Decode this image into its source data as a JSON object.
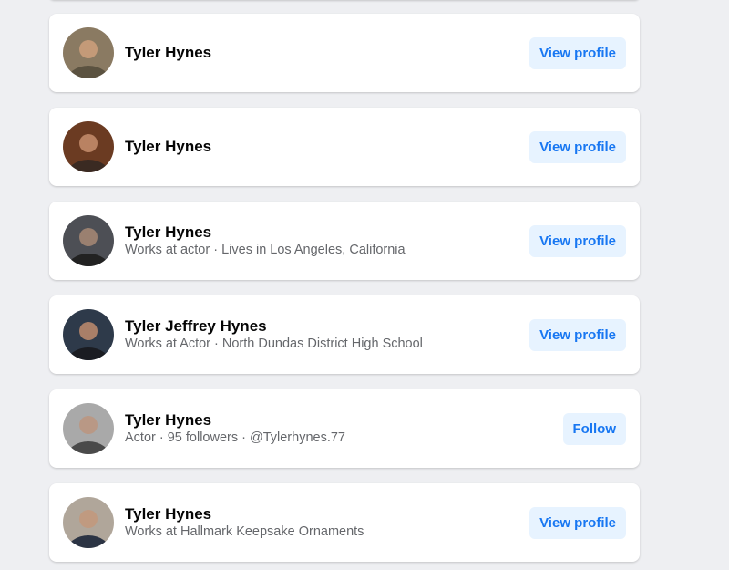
{
  "results": [
    {
      "name": "Tyler Hynes",
      "meta": "",
      "button": "View profile",
      "bg": "#8a7a62",
      "shirt": "#5b5240",
      "skin": "#c49a78"
    },
    {
      "name": "Tyler Hynes",
      "meta": "",
      "button": "View profile",
      "bg": "#6b3b22",
      "shirt": "#3a2a22",
      "skin": "#b98262"
    },
    {
      "name": "Tyler Hynes",
      "meta": "Works at actor · Lives in Los Angeles, California",
      "button": "View profile",
      "bg": "#4d4f55",
      "shirt": "#222222",
      "skin": "#9a8070"
    },
    {
      "name": "Tyler Jeffrey Hynes",
      "meta": "Works at Actor · North Dundas District High School",
      "button": "View profile",
      "bg": "#2e3a4a",
      "shirt": "#1a1c22",
      "skin": "#a97f68"
    },
    {
      "name": "Tyler Hynes",
      "meta": "Actor · 95 followers · @Tylerhynes.77",
      "button": "Follow",
      "bg": "#a9a9a9",
      "shirt": "#4a4a4a",
      "skin": "#b99885"
    },
    {
      "name": "Tyler Hynes",
      "meta": "Works at Hallmark Keepsake Ornaments",
      "button": "View profile",
      "bg": "#b0a69a",
      "shirt": "#2c3444",
      "skin": "#c09a80"
    }
  ]
}
